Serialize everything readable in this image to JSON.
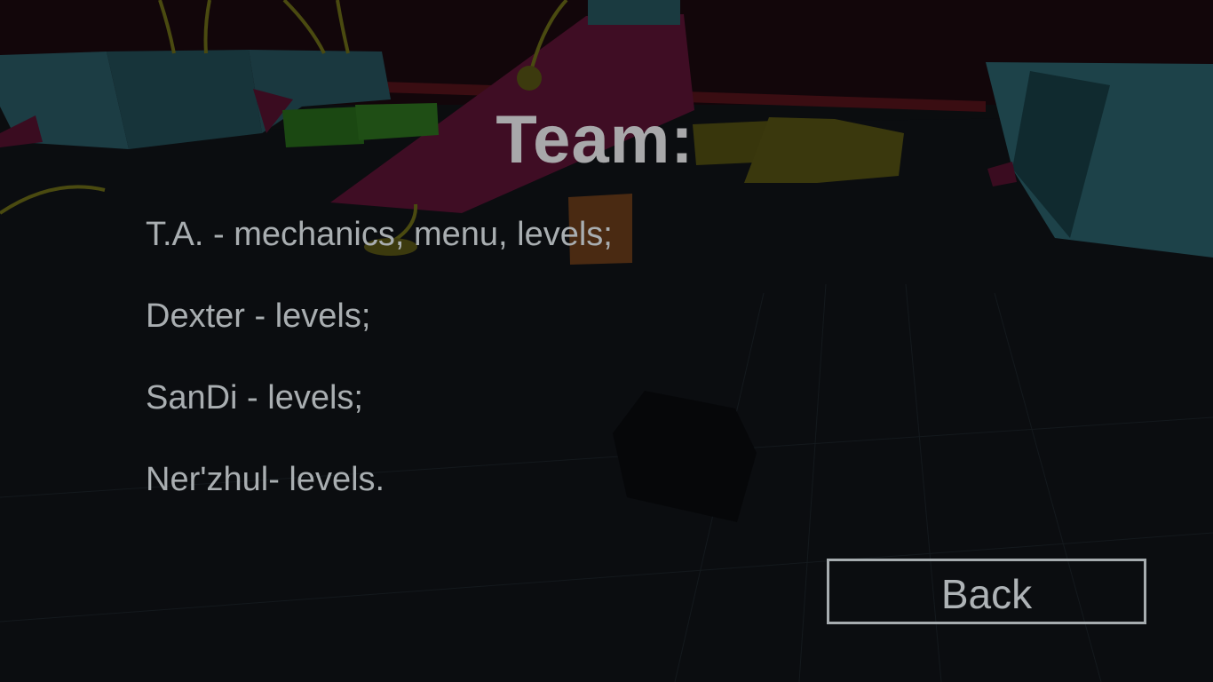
{
  "screen": {
    "title": "Team:",
    "credits": [
      "T.A. - mechanics, menu, levels;",
      "Dexter - levels;",
      "SanDi - levels;",
      "Ner'zhul- levels."
    ],
    "back_label": "Back"
  },
  "colors": {
    "text": "#a9aeb1",
    "title": "#a8a8aa",
    "button_border": "#a6acaf",
    "background": "#0b0d0f",
    "scene_cyan": "#1d4148",
    "scene_magenta": "#4a1029",
    "scene_green": "#1d4a14",
    "scene_yellow": "#3c3a0e",
    "scene_orange": "#4a2a12",
    "scene_back_wall": "#140608"
  }
}
